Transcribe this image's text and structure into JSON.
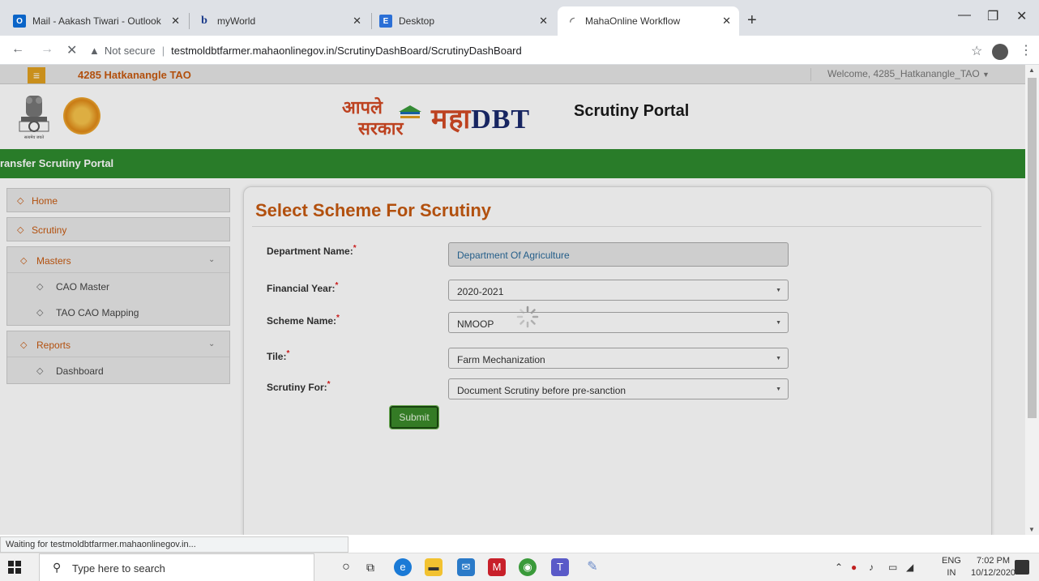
{
  "browser": {
    "tabs": [
      {
        "title": "Mail - Aakash Tiwari - Outlook",
        "icon": "outlook-icon"
      },
      {
        "title": "myWorld",
        "icon": "myworld-icon"
      },
      {
        "title": "Desktop",
        "icon": "desktop-app-icon"
      },
      {
        "title": "MahaOnline Workflow",
        "icon": "loading-icon"
      }
    ],
    "new_tab": "+",
    "security": "Not secure",
    "url": "testmoldbtfarmer.mahaonlinegov.in/ScrutinyDashBoard/ScrutinyDashBoard",
    "status": "Waiting for testmoldbtfarmer.mahaonlinegov.in..."
  },
  "header": {
    "office": "4285 Hatkanangle TAO",
    "welcome": "Welcome, 4285_Hatkanangle_TAO"
  },
  "banner": {
    "logo_line1": "आपले",
    "logo_line2": "सरकार",
    "brand_maha": "महा",
    "brand_dbt": "DBT",
    "portal_title": "Scrutiny Portal",
    "emblem_caption": "सत्यमेव जयते"
  },
  "greenbar": {
    "text": "ransfer Scrutiny Portal"
  },
  "sidebar": {
    "home": "Home",
    "scrutiny": "Scrutiny",
    "masters": {
      "label": "Masters",
      "items": [
        "CAO Master",
        "TAO CAO Mapping"
      ]
    },
    "reports": {
      "label": "Reports",
      "items": [
        "Dashboard"
      ]
    }
  },
  "form": {
    "title": "Select Scheme For Scrutiny",
    "required_mark": "*",
    "fields": [
      {
        "label": "Department Name:",
        "value": "Department Of Agriculture"
      },
      {
        "label": "Financial Year:",
        "value": "2020-2021"
      },
      {
        "label": "Scheme Name:",
        "value": "NMOOP"
      },
      {
        "label": "Tile:",
        "value": "Farm Mechanization"
      },
      {
        "label": "Scrutiny For:",
        "value": "Document Scrutiny before pre-sanction"
      }
    ],
    "submit": "Submit"
  },
  "taskbar": {
    "search_placeholder": "Type here to search",
    "lang_top": "ENG",
    "lang_bottom": "IN",
    "time": "7:02 PM",
    "date": "10/12/2020"
  },
  "colors": {
    "accent": "#c75a10",
    "green": "#2e8b2e",
    "navy": "#1a2a6c"
  }
}
